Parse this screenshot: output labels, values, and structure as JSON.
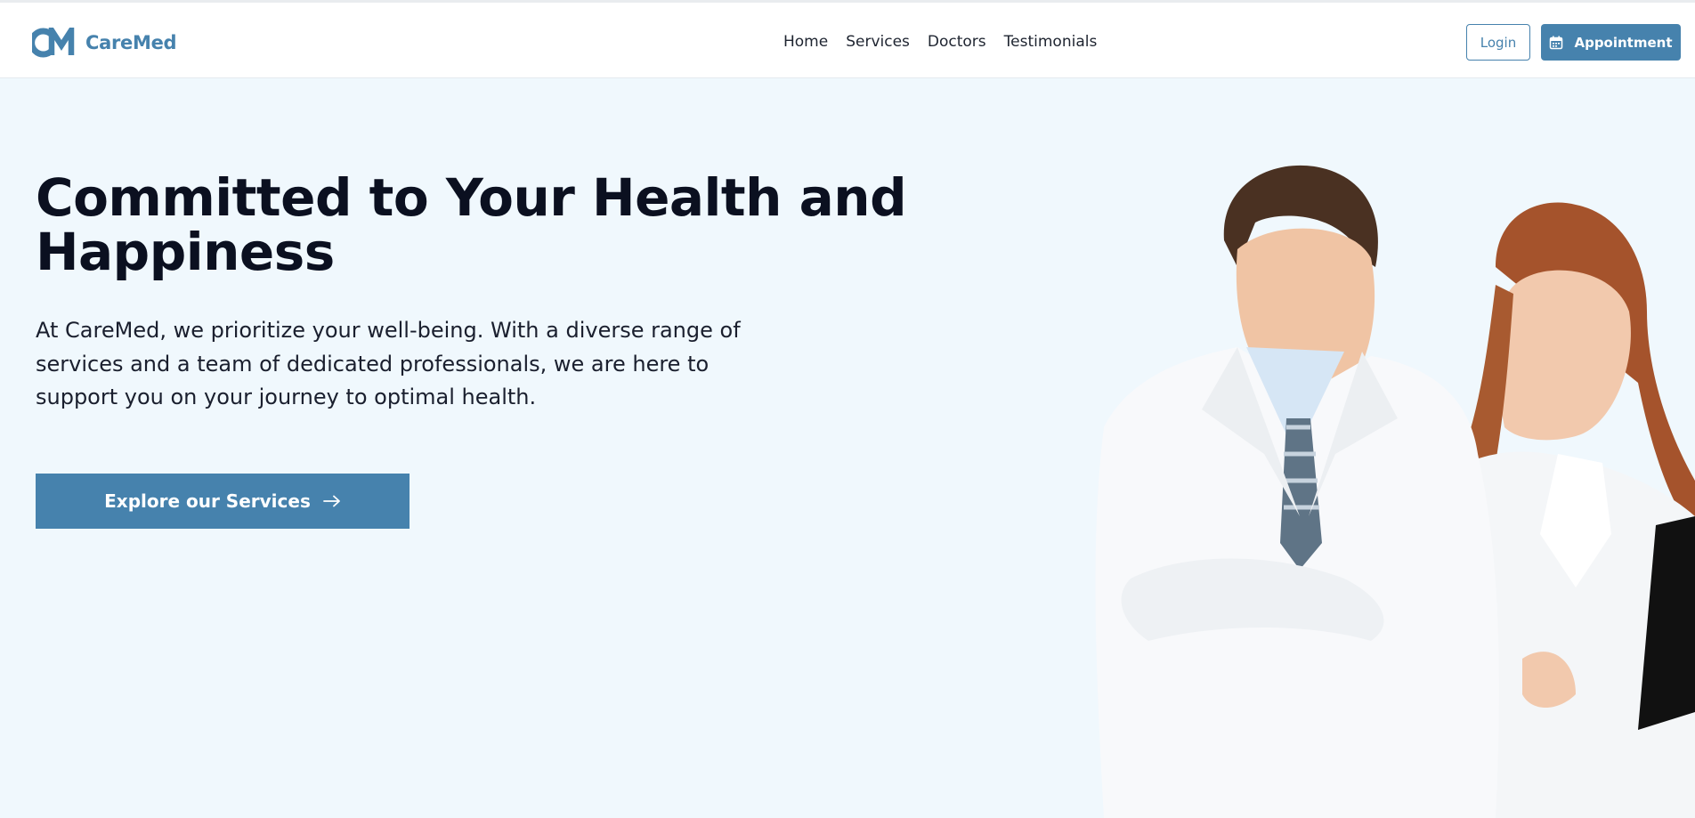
{
  "brand": {
    "logo_mark": "CM",
    "name": "CareMed",
    "color": "#4682ad"
  },
  "nav": {
    "links": [
      "Home",
      "Services",
      "Doctors",
      "Testimonials"
    ],
    "login_label": "Login",
    "appointment_label": "Appointment",
    "appointment_icon": "calendar-icon"
  },
  "hero": {
    "title": "Committed to Your Health and Happiness",
    "description": "At CareMed, we prioritize your well-being. With a diverse range of services and a team of dedicated professionals, we are here to support you on your journey to optimal health.",
    "cta_label": "Explore our Services",
    "cta_icon": "arrow-right-icon",
    "image_subject": "two-doctors-photo"
  },
  "colors": {
    "accent": "#4682ad",
    "hero_background": "#f0f8fd",
    "heading": "#0b1020"
  }
}
